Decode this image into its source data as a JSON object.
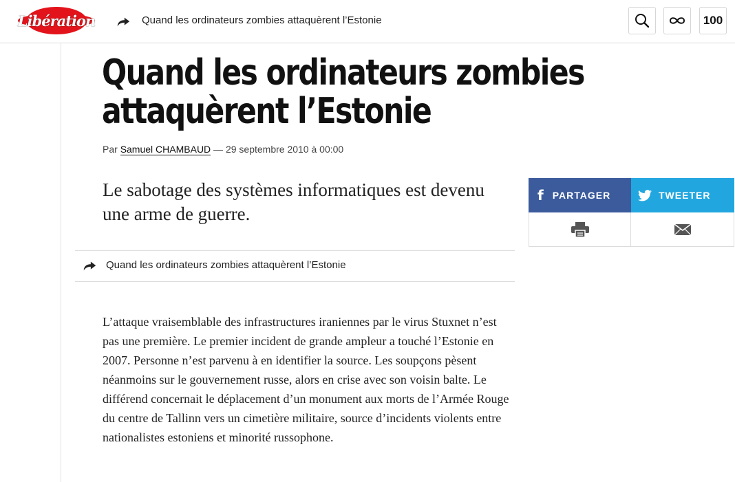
{
  "header": {
    "logo_text": "Libération",
    "article_title": "Quand les ordinateurs zombies attaquèrent l’Estonie",
    "hundred_label": "100",
    "icons": [
      "share-arrow-icon",
      "search-icon",
      "infinity-icon"
    ]
  },
  "article": {
    "title": "Quand les ordinateurs zombies attaquèrent l’Estonie",
    "title_line1": "Quand les ordinateurs zombies",
    "title_line2": "attaquèrent l’Estonie",
    "byline_prefix": "Par ",
    "author": "Samuel CHAMBAUD",
    "byline_suffix": " — 29 septembre 2010 à 00:00",
    "standfirst": "Le sabotage des systèmes informatiques est devenu une arme de guerre.",
    "related_title": "Quand les ordinateurs zombies attaquèrent l’Estonie",
    "body": "L’attaque vraisemblable des infrastructures iraniennes par le virus Stuxnet n’est pas une première. Le premier incident de grande ampleur a touché l’Estonie en 2007. Personne n’est parvenu à en identifier la source. Les soupçons pèsent néanmoins sur le gouvernement russe, alors en crise avec son voisin balte. Le différend concernait le déplacement d’un monument aux morts de l’Armée Rouge du centre de Tallinn vers un cimetière militaire, source d’incidents violents entre nationalistes estoniens et minorité russophone."
  },
  "share": {
    "facebook_label": "PARTAGER",
    "twitter_label": "TWEETER",
    "facebook_icon": "f",
    "icons": [
      "facebook-icon",
      "twitter-icon",
      "print-icon",
      "mail-icon"
    ]
  },
  "colors": {
    "logo_red": "#e3131b",
    "facebook": "#3b5b9c",
    "twitter": "#22a6e0"
  }
}
